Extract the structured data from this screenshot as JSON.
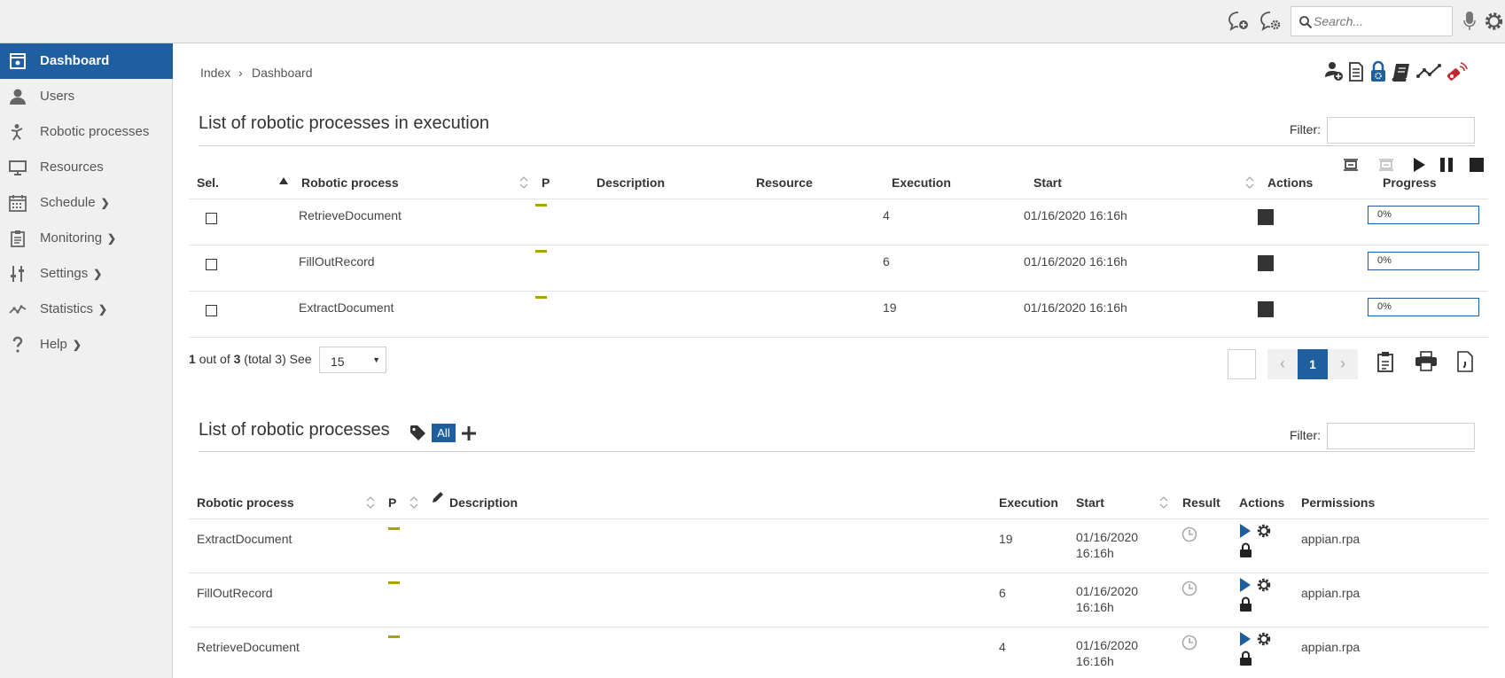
{
  "topbar": {
    "icons": [
      "add-comment-icon",
      "comment-settings-icon",
      "search-icon",
      "microphone-icon",
      "gear-icon"
    ],
    "search": {
      "placeholder": "Search..."
    }
  },
  "sidebar": {
    "items": [
      {
        "label": "Dashboard",
        "icon": "dashboard-icon",
        "active": true,
        "has_submenu": false
      },
      {
        "label": "Users",
        "icon": "user-icon",
        "active": false,
        "has_submenu": false
      },
      {
        "label": "Robotic processes",
        "icon": "robot-icon",
        "active": false,
        "has_submenu": false
      },
      {
        "label": "Resources",
        "icon": "monitor-icon",
        "active": false,
        "has_submenu": false
      },
      {
        "label": "Schedule",
        "icon": "calendar-icon",
        "active": false,
        "has_submenu": true
      },
      {
        "label": "Monitoring",
        "icon": "clipboard-icon",
        "active": false,
        "has_submenu": true
      },
      {
        "label": "Settings",
        "icon": "sliders-icon",
        "active": false,
        "has_submenu": true
      },
      {
        "label": "Statistics",
        "icon": "line-chart-icon",
        "active": false,
        "has_submenu": true
      },
      {
        "label": "Help",
        "icon": "help-icon",
        "active": false,
        "has_submenu": true
      }
    ]
  },
  "breadcrumb": {
    "items": [
      "Index",
      "Dashboard"
    ],
    "separator": "›"
  },
  "header_tools": [
    "add-user-icon",
    "document-icon",
    "lock-settings-icon",
    "scroll-icon",
    "statistics-icon",
    "usb-key-icon"
  ],
  "execution": {
    "title": "List of robotic processes in execution",
    "filter_label": "Filter:",
    "controls": [
      "select-all-icon",
      "deselect-all-icon",
      "play-icon",
      "pause-icon",
      "stop-icon"
    ],
    "columns": {
      "sel": "Sel.",
      "process": "Robotic process",
      "p": "P",
      "description": "Description",
      "resource": "Resource",
      "execution": "Execution",
      "start": "Start",
      "actions": "Actions",
      "progress": "Progress"
    },
    "rows": [
      {
        "process": "RetrieveDocument",
        "description": "",
        "resource": "",
        "execution": "4",
        "start": "01/16/2020 16:16h",
        "progress": "0%"
      },
      {
        "process": "FillOutRecord",
        "description": "",
        "resource": "",
        "execution": "6",
        "start": "01/16/2020 16:16h",
        "progress": "0%"
      },
      {
        "process": "ExtractDocument",
        "description": "",
        "resource": "",
        "execution": "19",
        "start": "01/16/2020 16:16h",
        "progress": "0%"
      }
    ],
    "pagination": {
      "current": "1",
      "out_of": "out of",
      "total_pages": "3",
      "total_text": "(total 3)",
      "see": "See",
      "page_size": "15",
      "page_button": "1"
    },
    "export_icons": [
      "clipboard-export-icon",
      "print-icon",
      "csv-icon"
    ]
  },
  "processes": {
    "title": "List of robotic processes",
    "tag_filter": "All",
    "filter_label": "Filter:",
    "columns": {
      "process": "Robotic process",
      "p": "P",
      "description": "Description",
      "execution": "Execution",
      "start": "Start",
      "result": "Result",
      "actions": "Actions",
      "permissions": "Permissions"
    },
    "rows": [
      {
        "process": "ExtractDocument",
        "description": "",
        "execution": "19",
        "start_date": "01/16/2020",
        "start_time": "16:16h",
        "permissions": "appian.rpa"
      },
      {
        "process": "FillOutRecord",
        "description": "",
        "execution": "6",
        "start_date": "01/16/2020",
        "start_time": "16:16h",
        "permissions": "appian.rpa"
      },
      {
        "process": "RetrieveDocument",
        "description": "",
        "execution": "4",
        "start_date": "01/16/2020",
        "start_time": "16:16h",
        "permissions": "appian.rpa"
      }
    ]
  },
  "colors": {
    "primary": "#1f5fa0",
    "priority_mark": "#a9a400",
    "sidebar_bg": "#f0f0f0",
    "usb_red": "#c0282d"
  }
}
